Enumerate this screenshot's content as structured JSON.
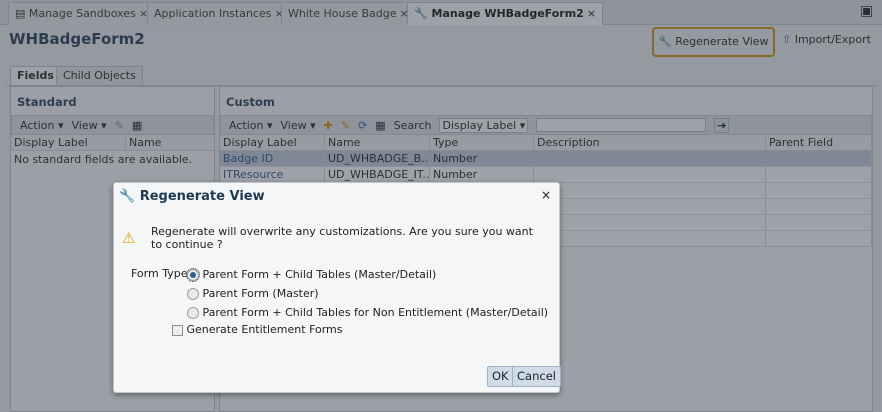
{
  "tabs": [
    {
      "label": "Manage Sandboxes"
    },
    {
      "label": "Application Instances"
    },
    {
      "label": "White House Badge"
    },
    {
      "label": "Manage WHBadgeForm2"
    }
  ],
  "close_glyph": "×",
  "page_title": "WHBadgeForm2",
  "header_actions": {
    "regenerate": "Regenerate View",
    "import_export": "Import/Export"
  },
  "subtabs": [
    "Fields",
    "Child Objects"
  ],
  "standard": {
    "heading": "Standard",
    "action": "Action",
    "view": "View",
    "columns": [
      "Display Label",
      "Name"
    ],
    "empty": "No standard fields are available."
  },
  "custom": {
    "heading": "Custom",
    "action": "Action",
    "view": "View",
    "search_label": "Search",
    "search_field": "Display Label",
    "columns": [
      "Display Label",
      "Name",
      "Type",
      "Description",
      "Parent Field"
    ],
    "rows": [
      [
        "Badge ID",
        "UD_WHBADGE_B...",
        "Number",
        "",
        ""
      ],
      [
        "ITResource",
        "UD_WHBADGE_IT...",
        "Number",
        "",
        ""
      ]
    ]
  },
  "dialog": {
    "title": "Regenerate View",
    "message": "Regenerate will overwrite any customizations. Are you sure you want to continue ?",
    "form_type_label": "Form Type",
    "options": [
      "Parent Form + Child Tables (Master/Detail)",
      "Parent Form (Master)",
      "Parent Form + Child Tables for Non Entitlement (Master/Detail)"
    ],
    "selected_option": 0,
    "checkbox_label": "Generate Entitlement Forms",
    "checkbox_checked": false,
    "ok": "OK",
    "cancel": "Cancel"
  },
  "colors": {
    "accent": "#c98a10",
    "title": "#1f3a52",
    "selected_row": "#b7c4d6"
  }
}
